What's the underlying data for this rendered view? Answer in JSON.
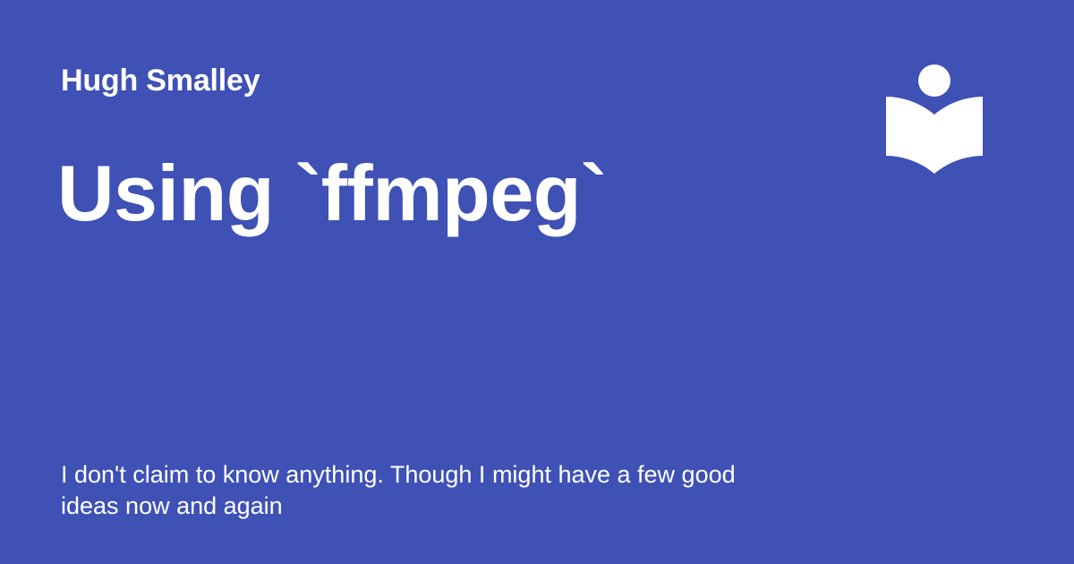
{
  "card": {
    "author": "Hugh Smalley",
    "title": "Using `ffmpeg`",
    "description": "I don't claim to know anything. Though I might have a few good ideas now and again",
    "logo_icon": "reader-book-icon"
  },
  "colors": {
    "background": "#3f51b5",
    "text": "#ffffff"
  }
}
